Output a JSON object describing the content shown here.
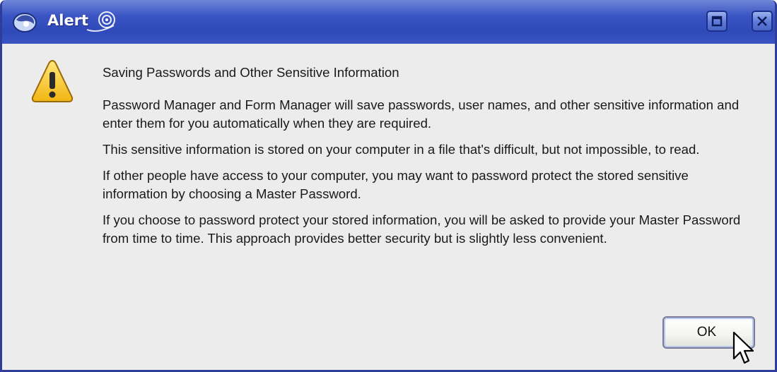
{
  "window": {
    "title": "Alert",
    "icons": {
      "app": "app-icon",
      "title_logo": "title-logo-icon",
      "maximize": "maximize-icon",
      "close": "close-icon",
      "warning": "warning-icon",
      "cursor": "mouse-cursor-icon"
    }
  },
  "dialog": {
    "heading": "Saving Passwords and Other Sensitive Information",
    "paragraphs": [
      "Password Manager and Form Manager will save passwords, user names, and other sensitive information and enter them for you automatically when they are required.",
      "This sensitive information is stored on your computer in a file that's difficult, but not impossible, to read.",
      "If other people have access to your computer, you may want to password protect the stored sensitive information by choosing a Master Password.",
      "If you choose to password protect your stored information, you will be asked to provide your Master Password from time to time. This approach provides better security but is slightly less convenient."
    ],
    "ok_label": "OK"
  },
  "colors": {
    "titlebar": "#2e49b8",
    "border": "#2f3d9a",
    "dialog_bg": "#ececec",
    "warning_yellow": "#f6c21c"
  }
}
